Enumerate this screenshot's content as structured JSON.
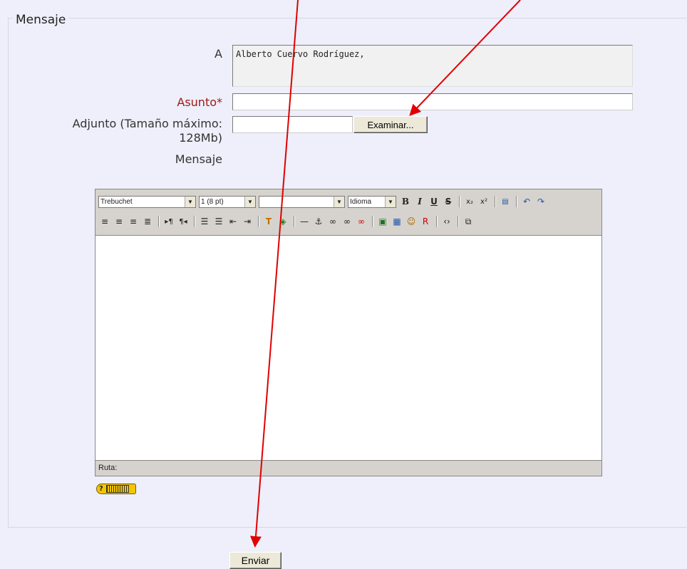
{
  "form": {
    "legend": "Mensaje",
    "to_label": "A",
    "to_value": "Alberto Cuervo Rodríguez,",
    "subject_label": "Asunto*",
    "attachment_label": "Adjunto (Tamaño máximo: 128Mb)",
    "browse_button": "Examinar...",
    "message_label": "Mensaje",
    "submit_button": "Enviar"
  },
  "editor": {
    "font_family": "Trebuchet",
    "font_size": "1 (8 pt)",
    "format": "",
    "language": "Idioma",
    "path_label": "Ruta:",
    "toolbar_row1": [
      "bold-icon",
      "italic-icon",
      "underline-icon",
      "strikethrough-icon",
      "subscript-icon",
      "superscript-icon",
      "paste-word-icon",
      "undo-icon",
      "redo-icon"
    ],
    "toolbar_row2": [
      "align-left-icon",
      "align-center-icon",
      "align-right-icon",
      "justify-icon",
      "ltr-icon",
      "rtl-icon",
      "ordered-list-icon",
      "unordered-list-icon",
      "outdent-icon",
      "indent-icon",
      "text-color-icon",
      "bg-color-icon",
      "horizontal-rule-icon",
      "anchor-icon",
      "link-icon",
      "unlink-icon",
      "nolink-icon",
      "image-icon",
      "table-icon",
      "smiley-icon",
      "search-replace-icon",
      "html-source-icon",
      "fullscreen-icon"
    ]
  },
  "annotations": {
    "arrow_color": "#e00000"
  }
}
